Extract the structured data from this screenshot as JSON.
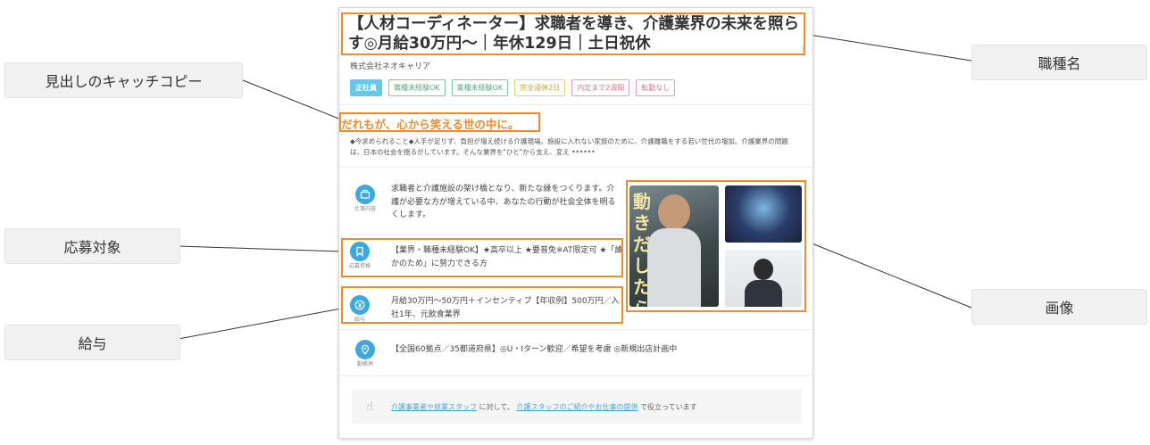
{
  "labels": {
    "catchcopy": "見出しのキャッチコピー",
    "target": "応募対象",
    "salary": "給与",
    "job_type": "職種名",
    "image": "画像"
  },
  "job": {
    "title": "【人材コーディネーター】求職者を導き、介護業界の未来を照らす◎月給30万円～｜年休129日｜土日祝休",
    "company": "株式会社ネオキャリア",
    "tags": [
      "正社員",
      "職種未経験OK",
      "業種未経験OK",
      "完全週休2日",
      "内定まで2週間",
      "転勤なし"
    ],
    "catchcopy": "だれもが、心から笑える世の中に。",
    "description": "◆今求められること◆人手が足りず、負担が増え続ける介護現場。施設に入れない家族のために、介護離職をする若い世代の増加。介護業界の問題は、日本の社会を揺るがしています。そんな業界を\"ひと\"から支え、変え ••••••",
    "rows": [
      {
        "icon": "briefcase-icon",
        "label": "仕事内容",
        "text": "求職者と介護施設の架け橋となり、新たな縁をつくります。介護が必要な方が増えている中、あなたの行動が社会全体を明るくします。"
      },
      {
        "icon": "bookmark-icon",
        "label": "応募資格",
        "text": "【業界・職種未経験OK】★高卒以上 ★要普免※AT限定可 ★「誰かのため」に努力できる方"
      },
      {
        "icon": "yen-icon",
        "label": "給与",
        "text": "月給30万円～50万円＋インセンティブ【年収例】500万円／入社1年、元飲食業界"
      },
      {
        "icon": "map-pin-icon",
        "label": "勤務地",
        "text": "【全国60拠点／35都道府県】◎U・Iターン歓迎／希望を考慮 ◎新規出店計画中"
      }
    ],
    "photo_text": "動 きだしたら 変わっていた",
    "footer": {
      "link1": "介護事業者や就業スタッフ",
      "mid": "に対して、",
      "link2": "介護スタッフのご紹介やお仕事の提供",
      "end": "で役立っています"
    }
  },
  "colors": {
    "highlight": "#f08a2a",
    "accent_blue": "#3ea7dc",
    "catch_orange": "#f08a2a"
  }
}
